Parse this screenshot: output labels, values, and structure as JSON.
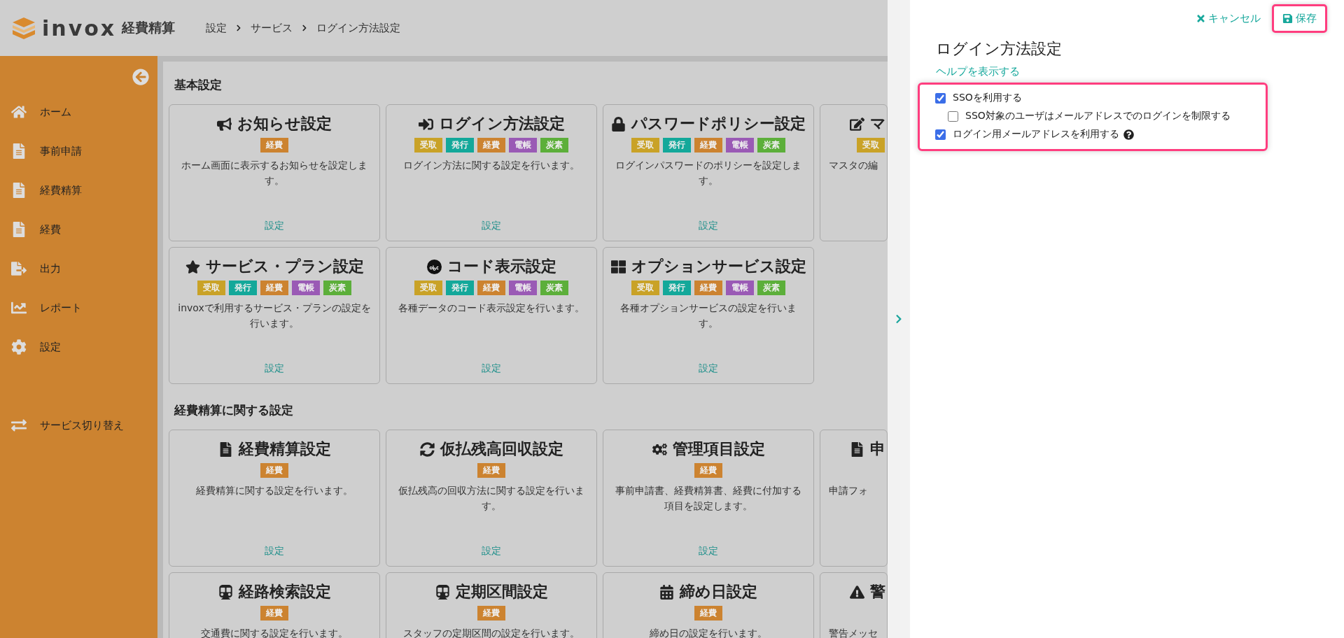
{
  "header": {
    "logo_text": "invox",
    "product": "経費精算",
    "breadcrumb": [
      "設定",
      "サービス",
      "ログイン方法設定"
    ]
  },
  "sidebar": {
    "items": [
      {
        "label": "ホーム"
      },
      {
        "label": "事前申請"
      },
      {
        "label": "経費精算"
      },
      {
        "label": "経費"
      },
      {
        "label": "出力"
      },
      {
        "label": "レポート"
      },
      {
        "label": "設定"
      }
    ],
    "switch_label": "サービス切り替え"
  },
  "sections": [
    {
      "title": "基本設定",
      "cards": [
        {
          "title": "お知らせ設定",
          "tags": [
            {
              "label": "経費",
              "color": "#cc8330"
            }
          ],
          "description": "ホーム画面に表示するお知らせを設定します。",
          "link": "設定"
        },
        {
          "title": "ログイン方法設定",
          "tags": [
            {
              "label": "受取",
              "color": "#c9a227"
            },
            {
              "label": "発行",
              "color": "#13a89a"
            },
            {
              "label": "経費",
              "color": "#cc8330"
            },
            {
              "label": "電帳",
              "color": "#9a5ab5"
            },
            {
              "label": "炭素",
              "color": "#5caf3a"
            }
          ],
          "description": "ログイン方法に関する設定を行います。",
          "link": "設定"
        },
        {
          "title": "パスワードポリシー設定",
          "tags": [
            {
              "label": "受取",
              "color": "#c9a227"
            },
            {
              "label": "発行",
              "color": "#13a89a"
            },
            {
              "label": "経費",
              "color": "#cc8330"
            },
            {
              "label": "電帳",
              "color": "#9a5ab5"
            },
            {
              "label": "炭素",
              "color": "#5caf3a"
            }
          ],
          "description": "ログインパスワードのポリシーを設定します。",
          "link": "設定"
        },
        {
          "title": "マ",
          "tags": [
            {
              "label": "受取",
              "color": "#c9a227"
            }
          ],
          "description": "マスタの編"
        },
        {
          "title": "サービス・プラン設定",
          "tags": [
            {
              "label": "受取",
              "color": "#c9a227"
            },
            {
              "label": "発行",
              "color": "#13a89a"
            },
            {
              "label": "経費",
              "color": "#cc8330"
            },
            {
              "label": "電帳",
              "color": "#9a5ab5"
            },
            {
              "label": "炭素",
              "color": "#5caf3a"
            }
          ],
          "description": "invoxで利用するサービス・プランの設定を行います。",
          "link": "設定"
        },
        {
          "title": "コード表示設定",
          "tags": [
            {
              "label": "受取",
              "color": "#c9a227"
            },
            {
              "label": "発行",
              "color": "#13a89a"
            },
            {
              "label": "経費",
              "color": "#cc8330"
            },
            {
              "label": "電帳",
              "color": "#9a5ab5"
            },
            {
              "label": "炭素",
              "color": "#5caf3a"
            }
          ],
          "description": "各種データのコード表示設定を行います。",
          "link": "設定"
        },
        {
          "title": "オプションサービス設定",
          "tags": [
            {
              "label": "受取",
              "color": "#c9a227"
            },
            {
              "label": "発行",
              "color": "#13a89a"
            },
            {
              "label": "経費",
              "color": "#cc8330"
            },
            {
              "label": "電帳",
              "color": "#9a5ab5"
            },
            {
              "label": "炭素",
              "color": "#5caf3a"
            }
          ],
          "description": "各種オプションサービスの設定を行います。",
          "link": "設定"
        }
      ]
    },
    {
      "title": "経費精算に関する設定",
      "cards": [
        {
          "title": "経費精算設定",
          "tags": [
            {
              "label": "経費",
              "color": "#cc8330"
            }
          ],
          "description": "経費精算に関する設定を行います。",
          "link": "設定"
        },
        {
          "title": "仮払残高回収設定",
          "tags": [
            {
              "label": "経費",
              "color": "#cc8330"
            }
          ],
          "description": "仮払残高の回収方法に関する設定を行います。",
          "link": "設定"
        },
        {
          "title": "管理項目設定",
          "tags": [
            {
              "label": "経費",
              "color": "#cc8330"
            }
          ],
          "description": "事前申請書、経費精算書、経費に付加する項目を設定します。",
          "link": "設定"
        },
        {
          "title": "申",
          "description": "申請フォ"
        },
        {
          "title": "経路検索設定",
          "tags": [
            {
              "label": "経費",
              "color": "#cc8330"
            }
          ],
          "description": "交通費に関する設定を行います。"
        },
        {
          "title": "定期区間設定",
          "tags": [
            {
              "label": "経費",
              "color": "#cc8330"
            }
          ],
          "description": "スタッフの定期区間の設定を行います。"
        },
        {
          "title": "締め日設定",
          "tags": [
            {
              "label": "経費",
              "color": "#cc8330"
            }
          ],
          "description": "締め日の設定を行います。"
        },
        {
          "title": "警",
          "description": "警告メッセ"
        }
      ]
    }
  ],
  "panel": {
    "cancel": "キャンセル",
    "save": "保存",
    "title": "ログイン方法設定",
    "help": "ヘルプを表示する",
    "options": [
      {
        "label": "SSOを利用する",
        "checked": true,
        "children": [
          {
            "label": "SSO対象のユーザはメールアドレスでのログインを制限する",
            "checked": false
          }
        ]
      },
      {
        "label": "ログイン用メールアドレスを利用する",
        "checked": true,
        "help": true
      }
    ]
  }
}
